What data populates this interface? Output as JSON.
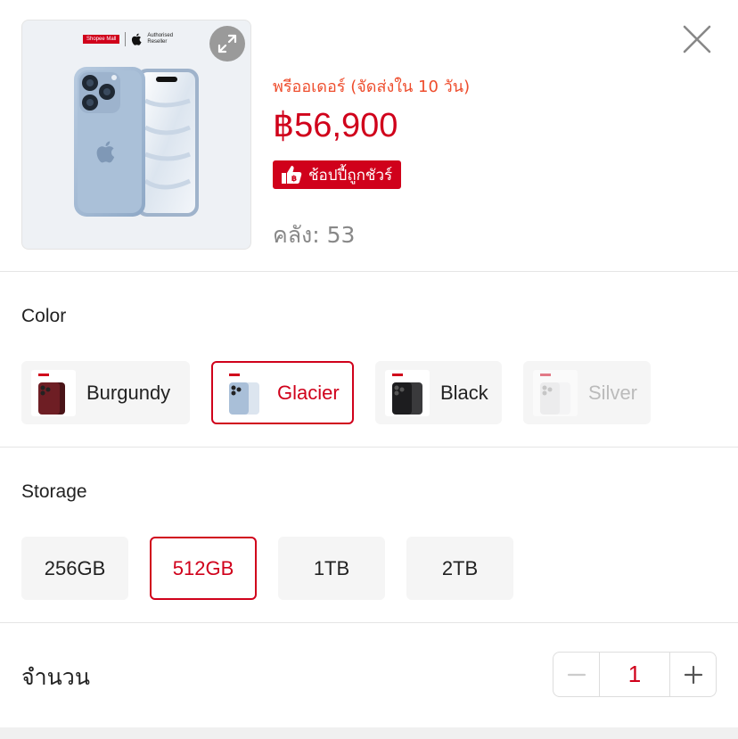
{
  "product": {
    "mall_badge": "Shopee Mall",
    "reseller_text": "Authorised\nReseller",
    "preorder": "พรีออเดอร์ (จัดส่งใน 10 วัน)",
    "price": "฿56,900",
    "guarantee_label": "ช้อปปี้ถูกชัวร์",
    "stock": "คลัง: 53"
  },
  "color_section": {
    "title": "Color",
    "options": [
      {
        "label": "Burgundy",
        "state": "normal",
        "swatch": "#6e1e24"
      },
      {
        "label": "Glacier",
        "state": "selected",
        "swatch": "#a9bfd8"
      },
      {
        "label": "Black",
        "state": "normal",
        "swatch": "#1d1d1f"
      },
      {
        "label": "Silver",
        "state": "disabled",
        "swatch": "#e4e4e6"
      }
    ]
  },
  "storage_section": {
    "title": "Storage",
    "options": [
      {
        "label": "256GB",
        "state": "normal"
      },
      {
        "label": "512GB",
        "state": "selected"
      },
      {
        "label": "1TB",
        "state": "normal"
      },
      {
        "label": "2TB",
        "state": "normal"
      }
    ]
  },
  "quantity": {
    "label": "จำนวน",
    "value": "1",
    "minus_icon": "minus-icon",
    "plus_icon": "plus-icon"
  },
  "icons": {
    "expand": "expand-icon",
    "close": "close-icon",
    "guarantee": "thumbs-up-baht-icon"
  },
  "colors": {
    "accent": "#d0011b",
    "preorder": "#ee4d2d"
  }
}
